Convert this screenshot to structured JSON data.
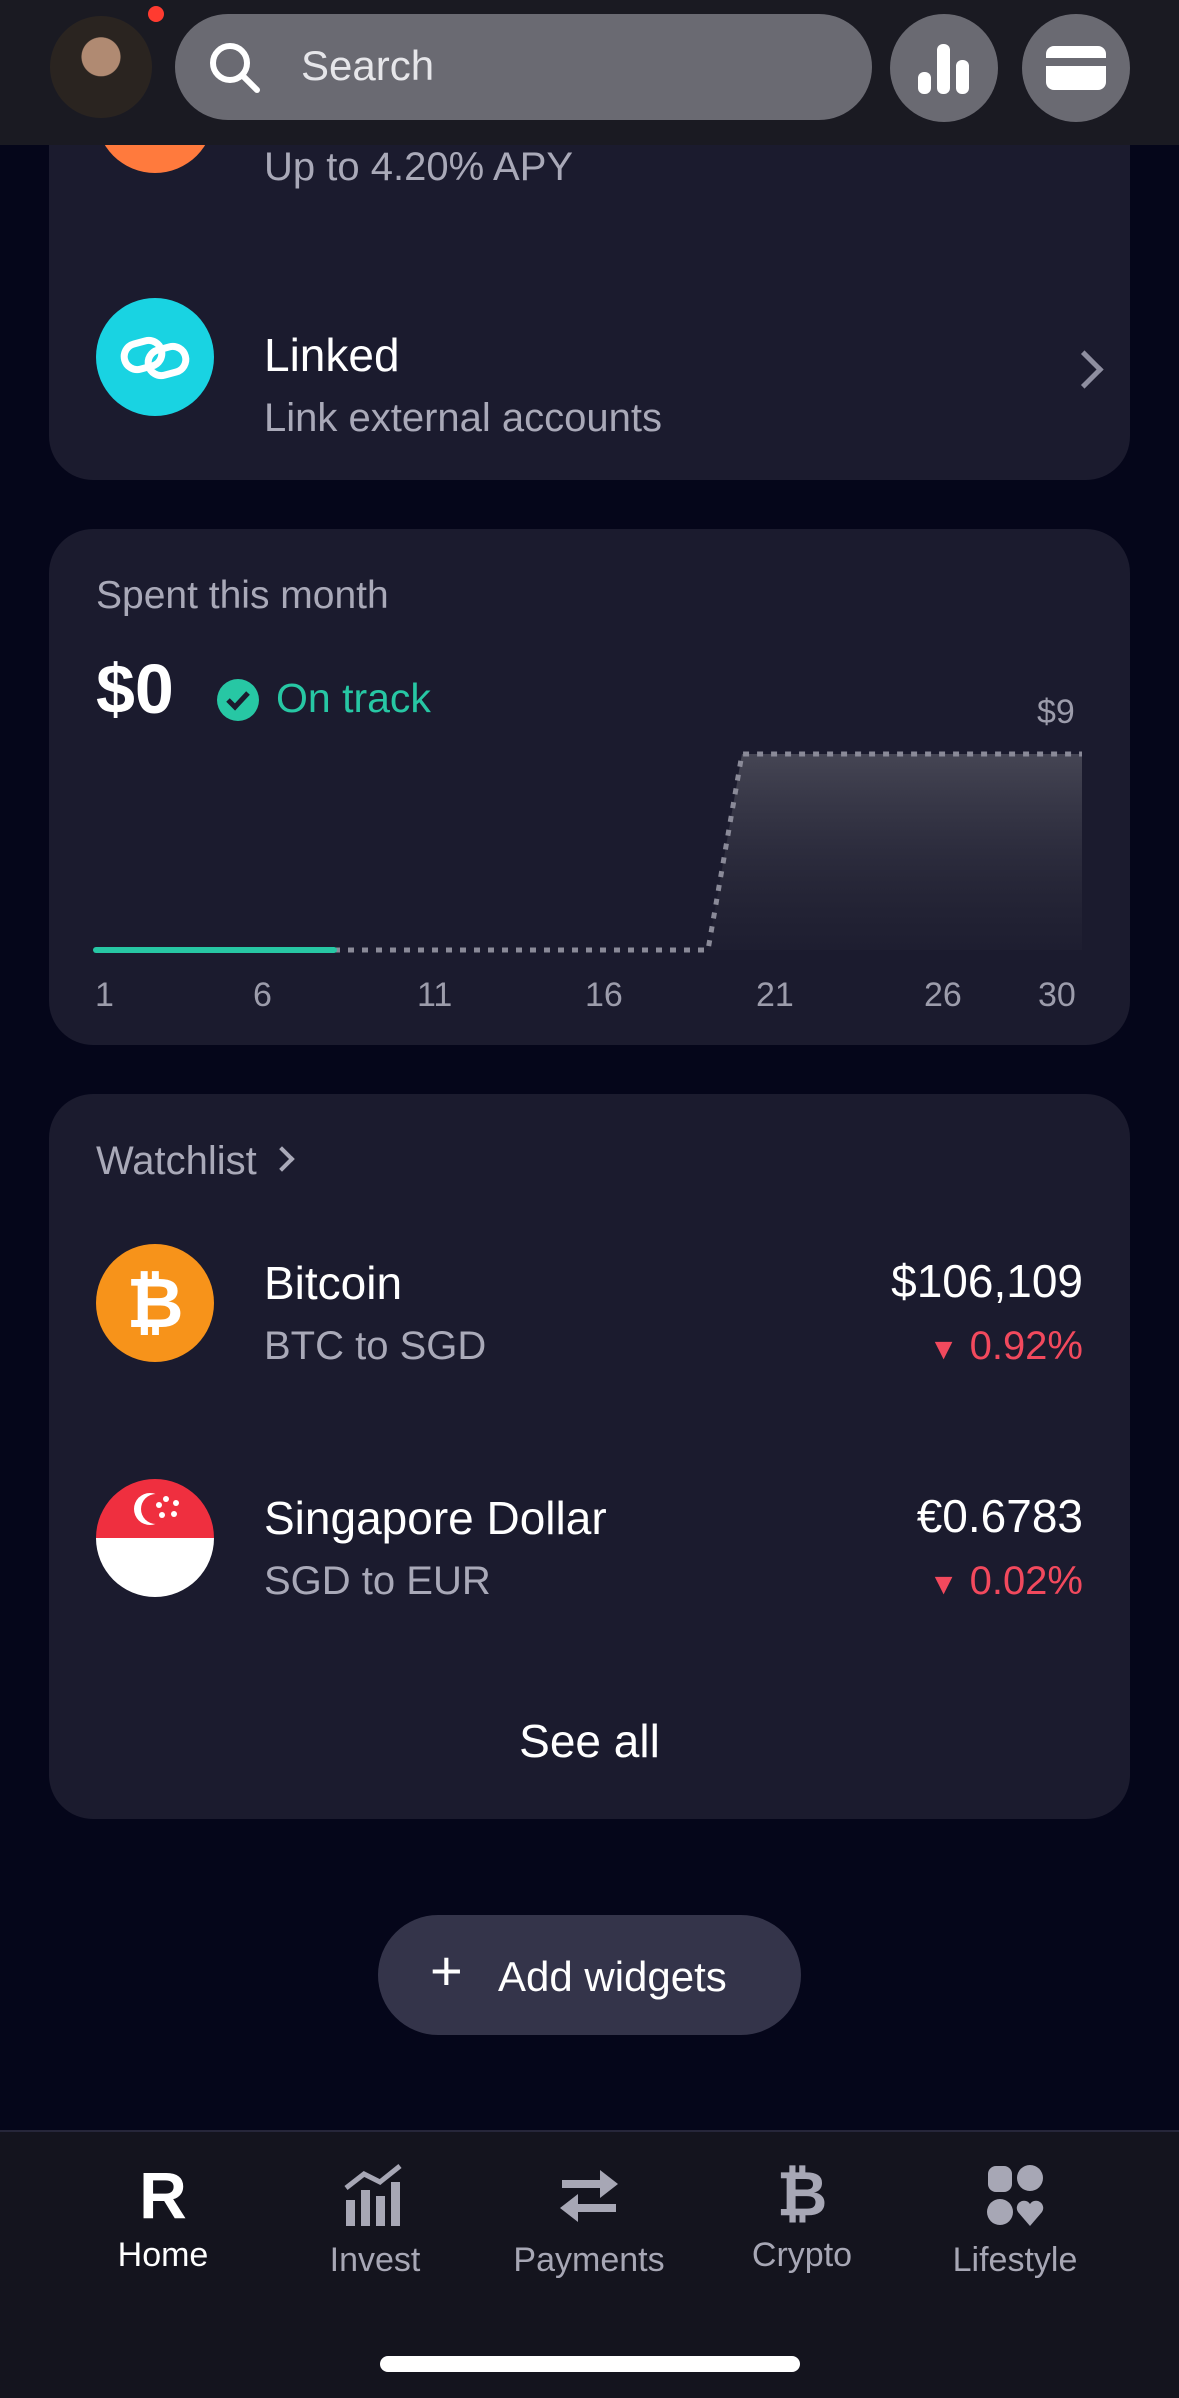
{
  "header": {
    "search_placeholder": "Search",
    "icons": [
      "avatar",
      "search-icon",
      "analytics-icon",
      "card-icon"
    ]
  },
  "accounts": {
    "savings_sub": "Up to 4.20% APY",
    "linked_title": "Linked",
    "linked_sub": "Link external accounts"
  },
  "spending": {
    "label": "Spent this month",
    "amount": "$0",
    "status": "On track",
    "budget_label": "$9",
    "colors": {
      "accent": "#27c7a4",
      "status": "#27c7a4"
    }
  },
  "chart_data": {
    "type": "line",
    "title": "",
    "x_ticks": [
      "1",
      "6",
      "11",
      "16",
      "21",
      "26",
      "30"
    ],
    "series": [
      {
        "x": [
          1,
          8
        ],
        "y": [
          0,
          0
        ]
      },
      {
        "x": [
          8,
          19,
          20,
          30
        ],
        "y": [
          0,
          0,
          9,
          9
        ]
      }
    ],
    "ylim": [
      0,
      9
    ],
    "xlim": [
      1,
      30
    ]
  },
  "watchlist": {
    "title": "Watchlist",
    "items": [
      {
        "name": "Bitcoin",
        "pair": "BTC to SGD",
        "price": "$106,109",
        "change": "0.92%"
      },
      {
        "name": "Singapore Dollar",
        "pair": "SGD to EUR",
        "price": "€0.6783",
        "change": "0.02%"
      }
    ],
    "see_all": "See all",
    "colors": {
      "down": "#f2495d",
      "bitcoin": "#f7931a"
    }
  },
  "add_widgets": {
    "label": "Add widgets"
  },
  "bottom_nav": {
    "items": [
      {
        "label": "Home",
        "icon": "revolut-r-icon",
        "active": true
      },
      {
        "label": "Invest",
        "icon": "invest-chart-icon",
        "active": false
      },
      {
        "label": "Payments",
        "icon": "transfer-arrows-icon",
        "active": false
      },
      {
        "label": "Crypto",
        "icon": "bitcoin-icon",
        "active": false
      },
      {
        "label": "Lifestyle",
        "icon": "lifestyle-icon",
        "active": false
      }
    ]
  }
}
